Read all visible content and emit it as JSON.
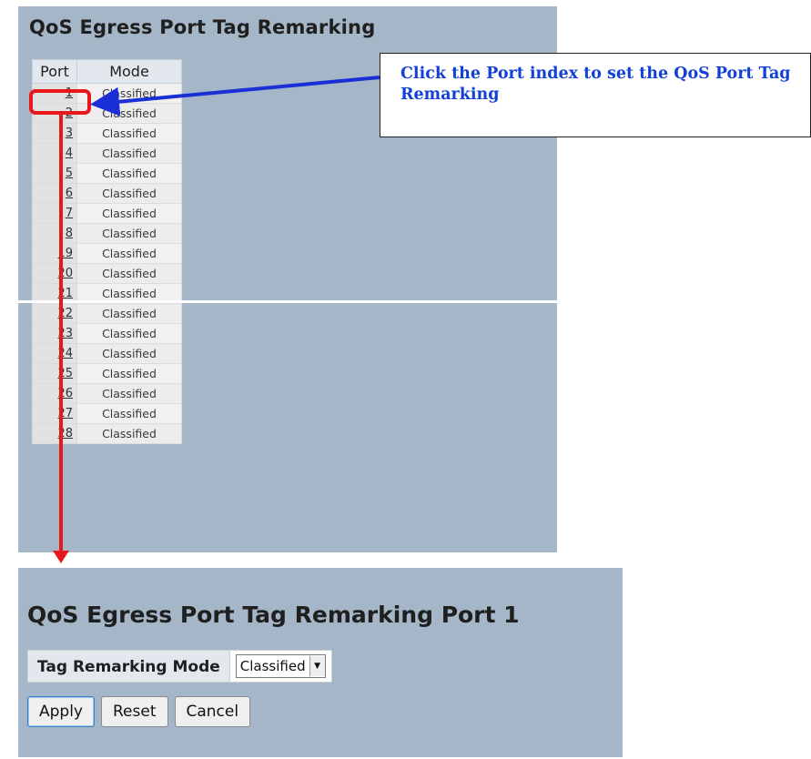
{
  "top": {
    "title": "QoS Egress Port Tag Remarking",
    "columns": [
      "Port",
      "Mode"
    ],
    "rows": [
      {
        "port": "1",
        "mode": "Classified"
      },
      {
        "port": "2",
        "mode": "Classified"
      },
      {
        "port": "3",
        "mode": "Classified"
      },
      {
        "port": "4",
        "mode": "Classified"
      },
      {
        "port": "5",
        "mode": "Classified"
      },
      {
        "port": "6",
        "mode": "Classified"
      },
      {
        "port": "7",
        "mode": "Classified"
      },
      {
        "port": "8",
        "mode": "Classified"
      },
      {
        "port": "19",
        "mode": "Classified"
      },
      {
        "port": "20",
        "mode": "Classified"
      },
      {
        "port": "21",
        "mode": "Classified"
      },
      {
        "port": "22",
        "mode": "Classified"
      },
      {
        "port": "23",
        "mode": "Classified"
      },
      {
        "port": "24",
        "mode": "Classified"
      },
      {
        "port": "25",
        "mode": "Classified"
      },
      {
        "port": "26",
        "mode": "Classified"
      },
      {
        "port": "27",
        "mode": "Classified"
      },
      {
        "port": "28",
        "mode": "Classified"
      }
    ]
  },
  "callout": {
    "text": "Click the Port index to set the QoS Port Tag Remarking"
  },
  "bottom": {
    "title": "QoS Egress Port Tag Remarking  Port 1",
    "mode_label": "Tag Remarking Mode",
    "mode_value": "Classified",
    "buttons": {
      "apply": "Apply",
      "reset": "Reset",
      "cancel": "Cancel"
    }
  },
  "colors": {
    "panel_bg": "#a4b6c7",
    "highlight": "#e8171b",
    "callout_text": "#1340d6",
    "arrow_blue": "#1a2fd6"
  },
  "icons": {
    "select_arrow": "triangle-down-icon"
  }
}
